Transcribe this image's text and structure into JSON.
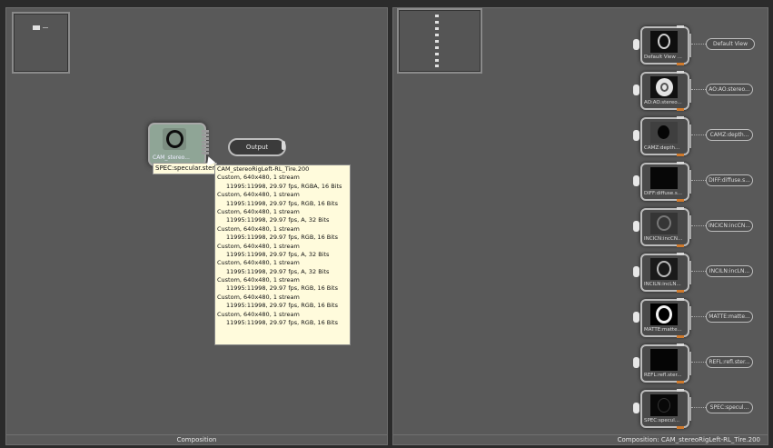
{
  "left_panel": {
    "footer_label": "Composition",
    "main_node": {
      "label": "CAM_stereo..."
    },
    "output_node": {
      "label": "Output"
    },
    "tooltip": "SPEC:specular.ster",
    "popup": {
      "title": "CAM_stereoRigLeft-RL_Tire.200",
      "streams": [
        {
          "desc": "Custom, 640x480, 1 stream",
          "detail": "11995:11998, 29.97 fps, RGBA, 16 Bits"
        },
        {
          "desc": "Custom, 640x480, 1 stream",
          "detail": "11995:11998, 29.97 fps, RGB, 16 Bits"
        },
        {
          "desc": "Custom, 640x480, 1 stream",
          "detail": "11995:11998, 29.97 fps, A, 32 Bits"
        },
        {
          "desc": "Custom, 640x480, 1 stream",
          "detail": "11995:11998, 29.97 fps, RGB, 16 Bits"
        },
        {
          "desc": "Custom, 640x480, 1 stream",
          "detail": "11995:11998, 29.97 fps, A, 32 Bits"
        },
        {
          "desc": "Custom, 640x480, 1 stream",
          "detail": "11995:11998, 29.97 fps, A, 32 Bits"
        },
        {
          "desc": "Custom, 640x480, 1 stream",
          "detail": "11995:11998, 29.97 fps, RGB, 16 Bits"
        },
        {
          "desc": "Custom, 640x480, 1 stream",
          "detail": "11995:11998, 29.97 fps, RGB, 16 Bits"
        },
        {
          "desc": "Custom, 640x480, 1 stream",
          "detail": "11995:11998, 29.97 fps, RGB, 16 Bits"
        }
      ]
    }
  },
  "right_panel": {
    "footer_label": "Composition: CAM_stereoRigLeft-RL_Tire.200",
    "nodes": [
      {
        "label": "Default View ...",
        "output": "Default View"
      },
      {
        "label": "AO:AO.stereo...",
        "output": "AO:AO.stereo..."
      },
      {
        "label": "CAMZ:depth...",
        "output": "CAMZ:depth..."
      },
      {
        "label": "DIFF:diffuse.s...",
        "output": "DIFF:diffuse.s..."
      },
      {
        "label": "INCICN:incCN...",
        "output": "INCICN:incCN..."
      },
      {
        "label": "INCILN:incLN...",
        "output": "INCILN:incLN..."
      },
      {
        "label": "MATTE:matte...",
        "output": "MATTE:matte..."
      },
      {
        "label": "REFL:refl.ster...",
        "output": "REFL:refl.ster..."
      },
      {
        "label": "SPEC:specul...",
        "output": "SPEC:specul..."
      }
    ]
  }
}
